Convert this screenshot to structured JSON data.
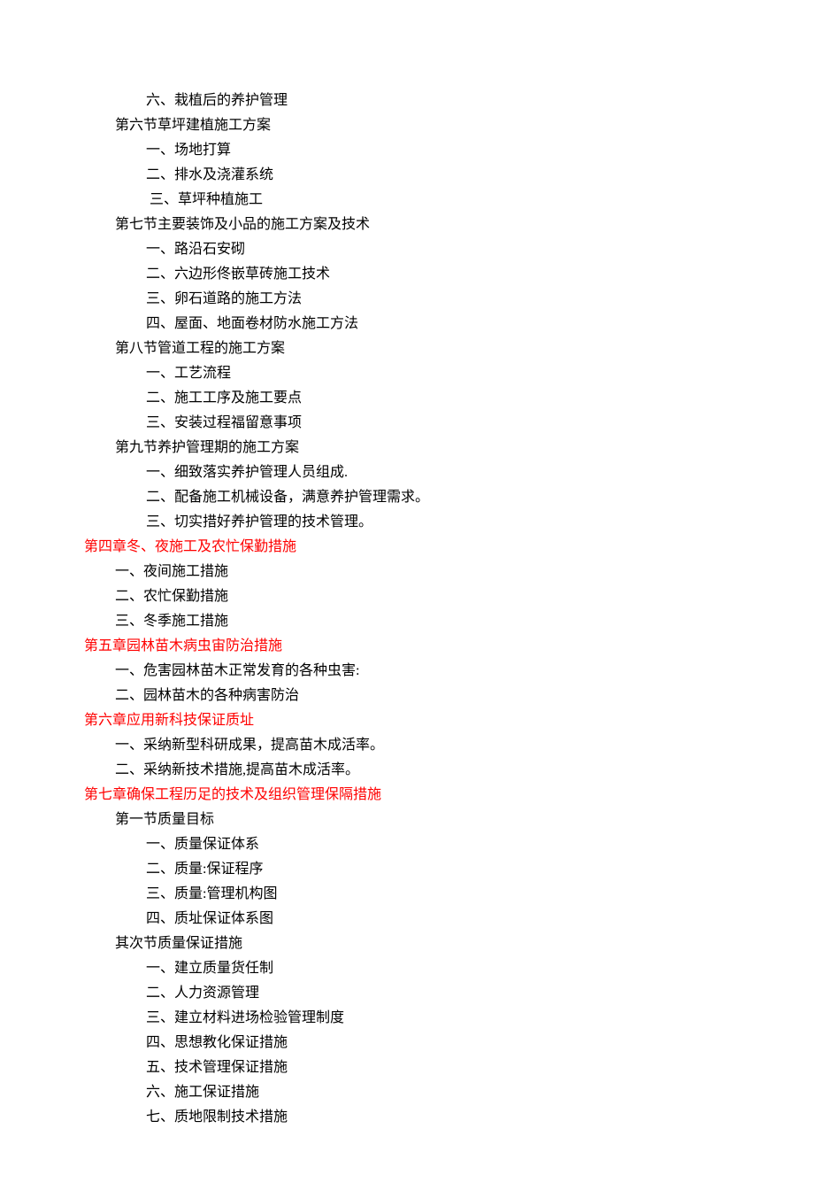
{
  "lines": [
    {
      "text": "六、栽植后的养护管理",
      "indent": "indent-2",
      "color": "black"
    },
    {
      "text": "第六节草坪建植施工方案",
      "indent": "indent-1",
      "color": "black"
    },
    {
      "text": "一、场地打算",
      "indent": "indent-2",
      "color": "black"
    },
    {
      "text": "二、排水及浇灌系统",
      "indent": "indent-2",
      "color": "black"
    },
    {
      "text": " 三、草坪种植施工",
      "indent": "indent-2",
      "color": "black"
    },
    {
      "text": "第七节主要装饰及小品的施工方案及技术",
      "indent": "indent-1",
      "color": "black"
    },
    {
      "text": "一、路沿石安砌",
      "indent": "indent-2",
      "color": "black"
    },
    {
      "text": "二、六边形佟嵌草砖施工技术",
      "indent": "indent-2",
      "color": "black"
    },
    {
      "text": "三、卵石道路的施工方法",
      "indent": "indent-2",
      "color": "black"
    },
    {
      "text": "四、屋面、地面卷材防水施工方法",
      "indent": "indent-2",
      "color": "black"
    },
    {
      "text": "第八节管道工程的施工方案",
      "indent": "indent-1",
      "color": "black"
    },
    {
      "text": "一、工艺流程",
      "indent": "indent-2",
      "color": "black"
    },
    {
      "text": "二、施工工序及施工要点",
      "indent": "indent-2",
      "color": "black"
    },
    {
      "text": "三、安装过程福留意事项",
      "indent": "indent-2",
      "color": "black"
    },
    {
      "text": "第九节养护管理期的施工方案",
      "indent": "indent-1",
      "color": "black"
    },
    {
      "text": "一、细致落实养护管理人员组成.",
      "indent": "indent-2",
      "color": "black"
    },
    {
      "text": "二、配备施工机械设备，满意养护管理需求。",
      "indent": "indent-2",
      "color": "black"
    },
    {
      "text": "三、切实措好养护管理的技术管理。",
      "indent": "indent-2",
      "color": "black"
    },
    {
      "text": "第四章冬、夜施工及农忙保勤措施",
      "indent": "indent-0",
      "color": "red"
    },
    {
      "text": "一、夜间施工措施",
      "indent": "indent-1",
      "color": "black"
    },
    {
      "text": "二、农忙保勤措施",
      "indent": "indent-1",
      "color": "black"
    },
    {
      "text": "三、冬季施工措施",
      "indent": "indent-1",
      "color": "black"
    },
    {
      "text": "第五章园林苗木病虫宙防治措施",
      "indent": "indent-0",
      "color": "red"
    },
    {
      "text": "一、危害园林苗木正常发育的各种虫害:",
      "indent": "indent-1",
      "color": "black"
    },
    {
      "text": "二、园林苗木的各种病害防治",
      "indent": "indent-1",
      "color": "black"
    },
    {
      "text": "第六章应用新科技保证质址",
      "indent": "indent-0",
      "color": "red"
    },
    {
      "text": "一、采纳新型科研成果，提高苗木成活率。",
      "indent": "indent-1",
      "color": "black"
    },
    {
      "text": "二、采纳新技术措施,提高苗木成活率。",
      "indent": "indent-1",
      "color": "black"
    },
    {
      "text": "第七章确保工程历足的技术及组织管理保隔措施",
      "indent": "indent-0",
      "color": "red"
    },
    {
      "text": "第一节质量目标",
      "indent": "indent-1",
      "color": "black"
    },
    {
      "text": "一、质量保证体系",
      "indent": "indent-2",
      "color": "black"
    },
    {
      "text": "二、质量:保证程序",
      "indent": "indent-2",
      "color": "black"
    },
    {
      "text": "三、质量:管理机构图",
      "indent": "indent-2",
      "color": "black"
    },
    {
      "text": "四、质址保证体系图",
      "indent": "indent-2",
      "color": "black"
    },
    {
      "text": "其次节质量保证措施",
      "indent": "indent-1",
      "color": "black"
    },
    {
      "text": "一、建立质量货任制",
      "indent": "indent-2",
      "color": "black"
    },
    {
      "text": "二、人力资源管理",
      "indent": "indent-2",
      "color": "black"
    },
    {
      "text": "三、建立材料进场检验管理制度",
      "indent": "indent-2",
      "color": "black"
    },
    {
      "text": "四、思想教化保证措施",
      "indent": "indent-2",
      "color": "black"
    },
    {
      "text": "五、技术管理保证措施",
      "indent": "indent-2",
      "color": "black"
    },
    {
      "text": "六、施工保证措施",
      "indent": "indent-2",
      "color": "black"
    },
    {
      "text": "七、质地限制技术措施",
      "indent": "indent-2",
      "color": "black"
    }
  ]
}
